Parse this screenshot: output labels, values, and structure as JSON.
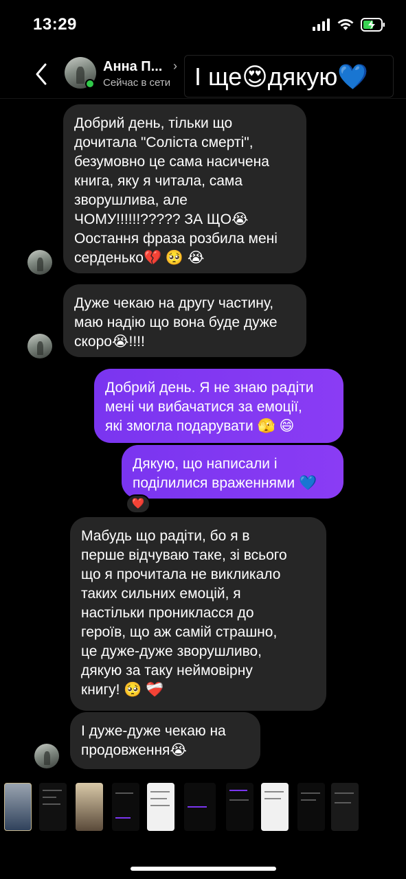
{
  "status_bar": {
    "time": "13:29"
  },
  "header": {
    "contact_name": "Анна П...",
    "status": "Сейчас в сети",
    "sticker_text": "І ще😍дякую💙"
  },
  "messages": [
    {
      "side": "in",
      "text": "Добрий день, тільки що\nдочитала \"Соліста смерті\",\nбезумовно це сама насичена\nкнига, яку я читала, сама\nзворушлива, але\nЧОМУ!!!!!!????? ЗА ЩО😭\nОостання фраза розбила мені\nсерденько💔 🥺 😭"
    },
    {
      "side": "in",
      "text": "Дуже чекаю на другу частину,\nмаю надію що вона буде дуже\nскоро😭!!!!"
    },
    {
      "side": "out",
      "text": "Добрий день. Я не знаю радіти\nмені чи вибачатися за емоції,\nякі змогла подарувати 🫣 😄"
    },
    {
      "side": "out",
      "text": "Дякую, що написали і\nподілилися враженнями 💙"
    },
    {
      "side": "in",
      "text": "Мабудь що радіти, бо я в\nперше відчуваю таке, зі всього\nщо я прочитала не викликало\nтаких сильних емоцій, я\nнастільки проникласся до\nгероїв, що аж самій страшно,\nце дуже-дуже зворушливо,\nдякую за таку неймовірну\nкнигу! 🥺 ❤️‍🩹"
    },
    {
      "side": "in",
      "text": "І дуже-дуже чекаю на\nпродовження😭"
    }
  ],
  "reaction": "❤️",
  "colors": {
    "incoming_bubble": "#262626",
    "outgoing_bubble": "#7a35f0",
    "online_dot": "#31c94a",
    "background": "#000000"
  }
}
